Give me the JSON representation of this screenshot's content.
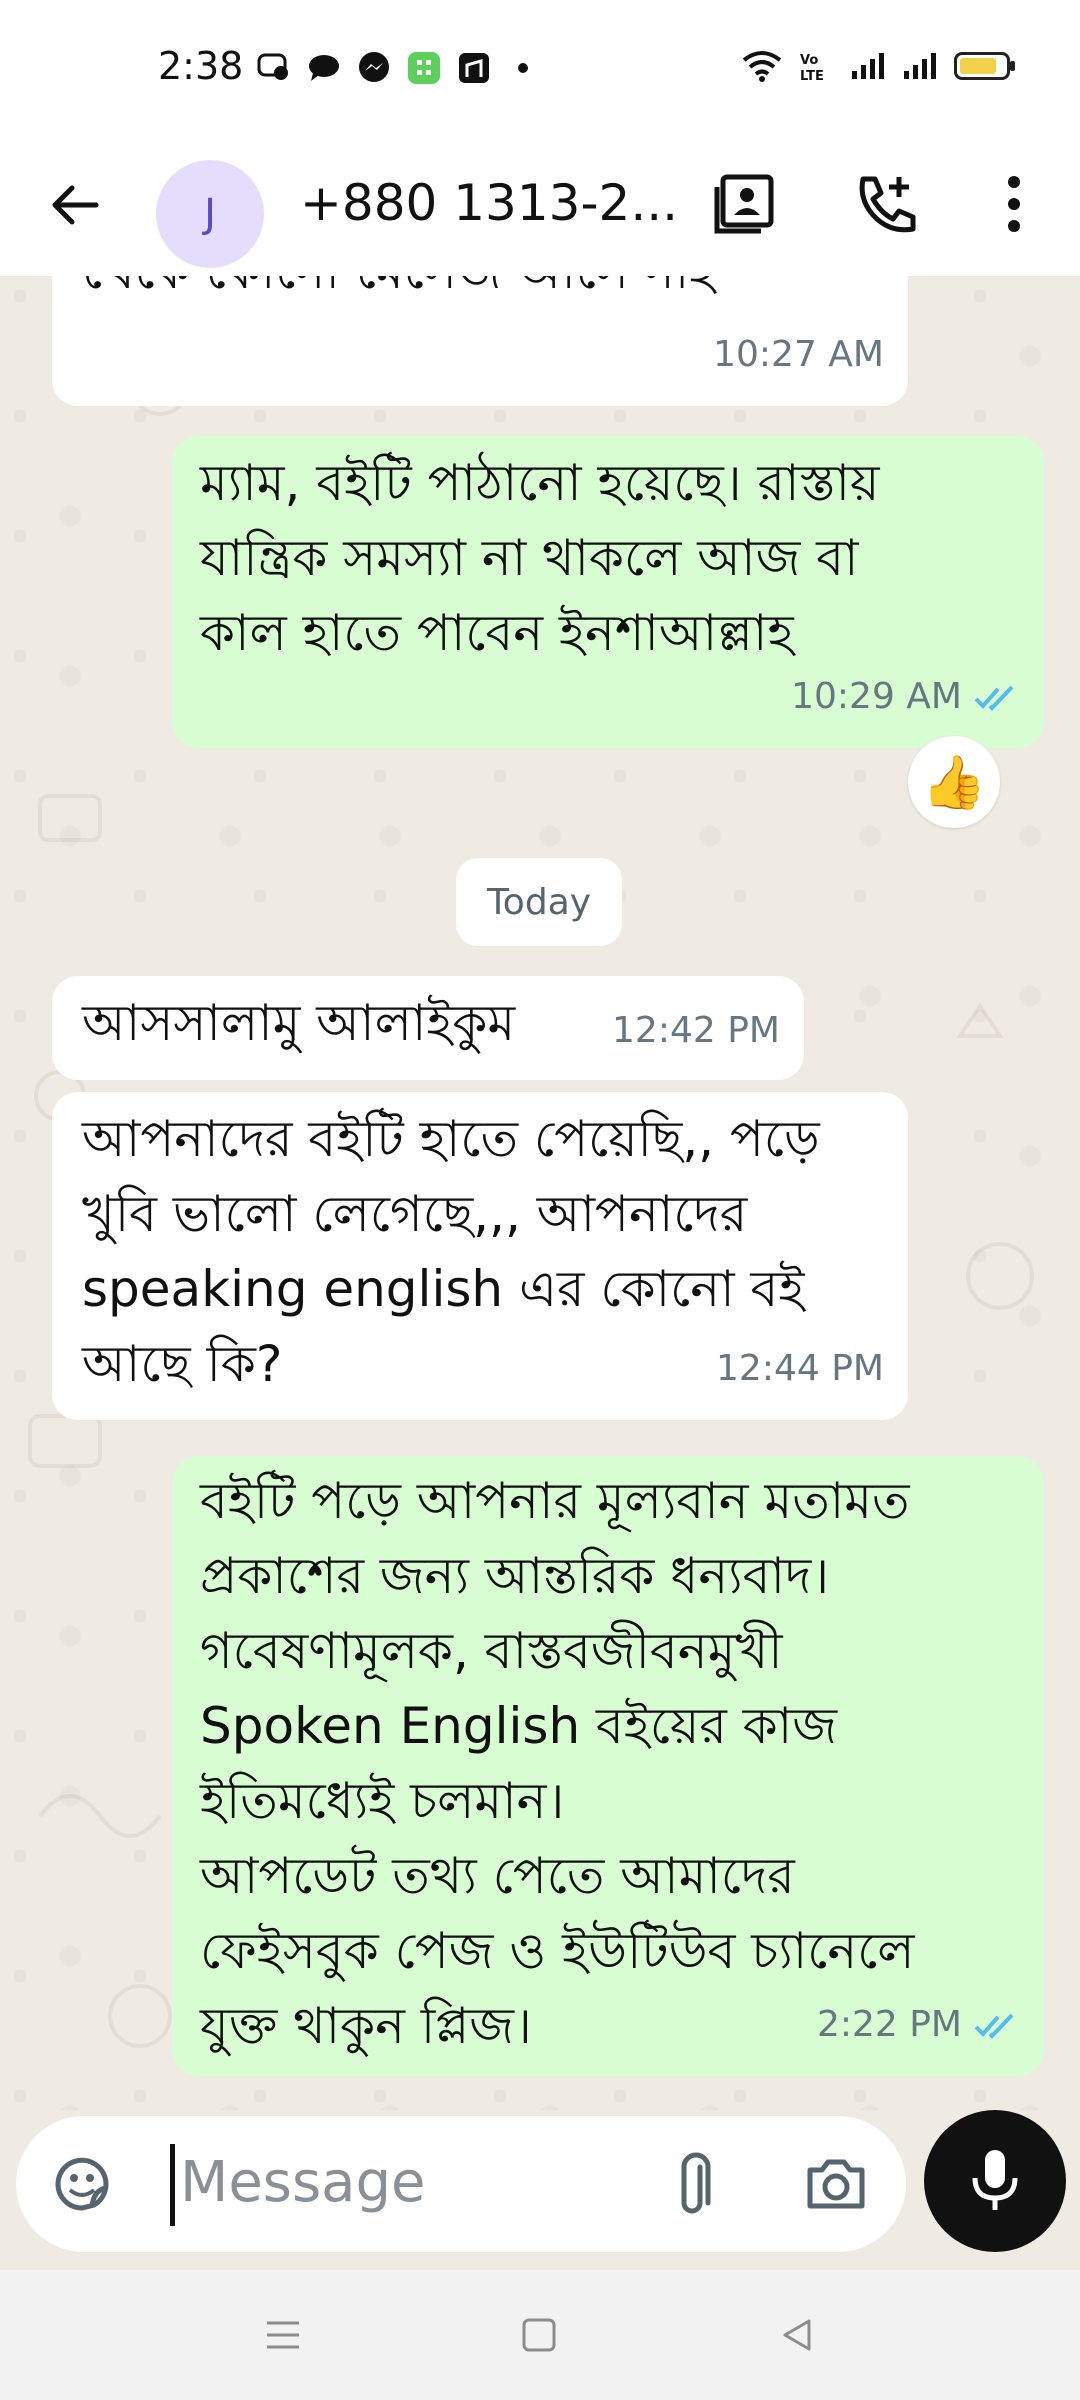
{
  "status_bar": {
    "time": "2:38",
    "left_icons": [
      "messenger-lite-icon",
      "chat-icon",
      "messenger-icon",
      "calculator-app-icon",
      "store-app-icon",
      "more-dot"
    ],
    "right_icons": [
      "wifi-icon",
      "volte-icon",
      "signal-icon",
      "signal-icon",
      "battery-icon"
    ]
  },
  "header": {
    "avatar_letter": "J",
    "contact": "+880 1313-2...",
    "icons": [
      "back-arrow-icon",
      "contact-card-icon",
      "add-call-icon",
      "more-vert-icon"
    ]
  },
  "messages": [
    {
      "dir": "in",
      "text": "থেকে কোনো মেসেজ আসে নাই",
      "time": "10:27 AM"
    },
    {
      "dir": "out",
      "text": "ম্যাম, বইটি পাঠানো হয়েছে। রাস্তায়\nযান্ত্রিক সমস্যা না থাকলে আজ বা\nকাল হাতে পাবেন ইনশাআল্লাহ",
      "time": "10:29 AM",
      "read": true,
      "reaction": "👍"
    },
    {
      "dir": "in",
      "text": "আসসালামু আলাইকুম",
      "time": "12:42 PM"
    },
    {
      "dir": "in",
      "text": "আপনাদের বইটি হাতে পেয়েছি,, পড়ে\nখুবি ভালো লেগেছে,,, আপনাদের\nspeaking english এর কোনো বই\nআছে কি?",
      "time": "12:44 PM"
    },
    {
      "dir": "out",
      "text": "বইটি পড়ে আপনার মূল্যবান মতামত\nপ্রকাশের জন্য আন্তরিক ধন্যবাদ।\nগবেষণামূলক, বাস্তবজীবনমুখী\nSpoken English বইয়ের কাজ\nইতিমধ্যেই চলমান।\nআপডেট তথ্য পেতে আমাদের\nফেইসবুক পেজ ও ইউটিউব চ্যানেলে\nযুক্ত থাকুন প্লিজ।",
      "time": "2:22 PM",
      "read": true
    }
  ],
  "date_chip": "Today",
  "input": {
    "placeholder": "Message",
    "icons": [
      "sticker-icon",
      "attach-icon",
      "camera-icon",
      "mic-icon"
    ]
  },
  "colors": {
    "incoming": "#ffffff",
    "outgoing": "#d9fdd3",
    "chat_bg": "#efeae2",
    "read_ticks": "#53bdeb",
    "avatar_bg": "#e4defc"
  },
  "nav_icons": [
    "menu-nav-icon",
    "home-nav-icon",
    "back-nav-icon"
  ]
}
